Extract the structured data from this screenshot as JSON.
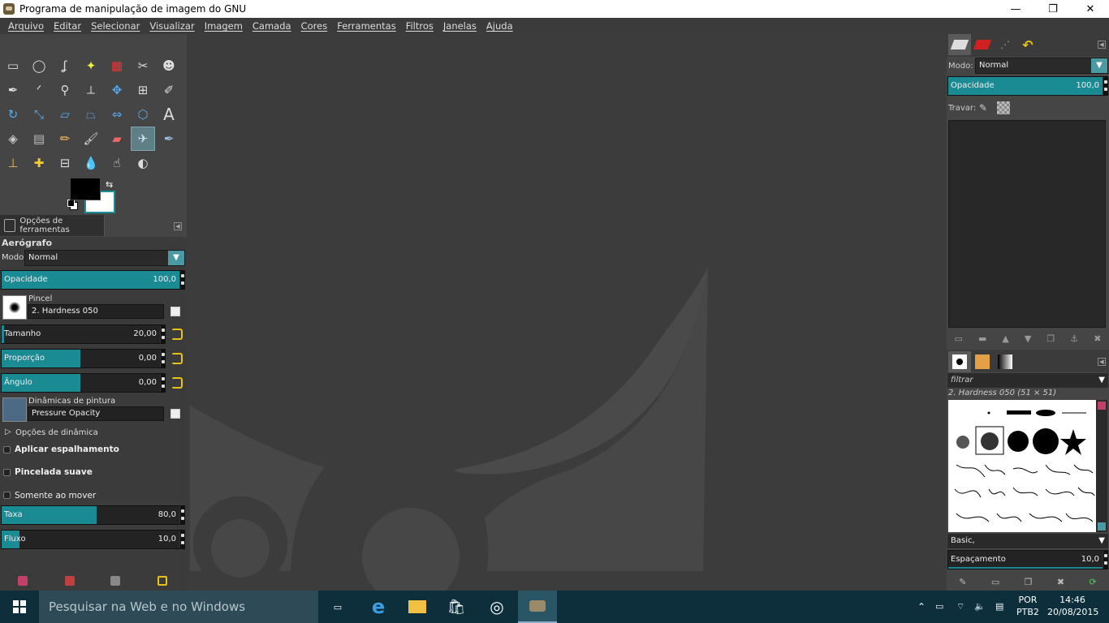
{
  "window": {
    "title": "Programa de manipulação de imagem do GNU",
    "minimize": "—",
    "maximize": "❐",
    "close": "✕"
  },
  "menu": [
    "Arquivo",
    "Editar",
    "Selecionar",
    "Visualizar",
    "Imagem",
    "Camada",
    "Cores",
    "Ferramentas",
    "Filtros",
    "Janelas",
    "Ajuda"
  ],
  "colors": {
    "accent": "#1b8b93",
    "fg": "#000000",
    "bg": "#ffffff"
  },
  "tools": [
    [
      "rect-select-icon",
      "ellipse-select-icon",
      "free-select-icon",
      "fuzzy-select-icon",
      "color-select-icon",
      "scissors-icon",
      "foreground-select-icon"
    ],
    [
      "paths-icon",
      "color-picker-icon",
      "zoom-icon",
      "measure-icon",
      "move-icon",
      "align-icon",
      "crop-icon"
    ],
    [
      "rotate-icon",
      "scale-icon",
      "shear-icon",
      "perspective-icon",
      "flip-icon",
      "cage-icon",
      "text-icon"
    ],
    [
      "bucket-fill-icon",
      "blend-icon",
      "pencil-icon",
      "paintbrush-icon",
      "eraser-icon",
      "airbrush-icon",
      "ink-icon"
    ],
    [
      "clone-icon",
      "heal-icon",
      "perspective-clone-icon",
      "blur-icon",
      "smudge-icon",
      "dodge-burn-icon"
    ]
  ],
  "tool_options": {
    "tab_label": "Opções de ferramentas",
    "title": "Aerógrafo",
    "mode_label": "Modo:",
    "mode_value": "Normal",
    "opacity": {
      "label": "Opacidade",
      "value": "100,0",
      "fraction": 1.0
    },
    "brush_label": "Pincel",
    "brush_value": "2. Hardness 050",
    "size": {
      "label": "Tamanho",
      "value": "20,00",
      "fraction": 0.01
    },
    "ratio": {
      "label": "Proporção",
      "value": "0,00",
      "fraction": 0.5
    },
    "angle": {
      "label": "Ângulo",
      "value": "0,00",
      "fraction": 0.5
    },
    "dynamics_label": "Dinâmicas de pintura",
    "dynamics_value": "Pressure Opacity",
    "dynamics_options": "Opções de dinâmica",
    "apply_jitter": "Aplicar espalhamento",
    "smooth_stroke": "Pincelada suave",
    "only_moving": "Somente ao mover",
    "rate": {
      "label": "Taxa",
      "value": "80,0",
      "fraction": 0.52
    },
    "flow": {
      "label": "Fluxo",
      "value": "10,0",
      "fraction": 0.1
    }
  },
  "layers": {
    "mode_label": "Modo:",
    "mode_value": "Normal",
    "opacity": {
      "label": "Opacidade",
      "value": "100,0",
      "fraction": 1.0
    },
    "lock_label": "Travar:"
  },
  "brushes": {
    "filter": "filtrar",
    "current": "2. Hardness 050 (51 × 51)",
    "tag": "Basic,",
    "spacing": {
      "label": "Espaçamento",
      "value": "10,0",
      "fraction": 1.0
    }
  },
  "taskbar": {
    "search_placeholder": "Pesquisar na Web e no Windows",
    "lang_top": "POR",
    "lang_bottom": "PTB2",
    "time": "14:46",
    "date": "20/08/2015"
  }
}
